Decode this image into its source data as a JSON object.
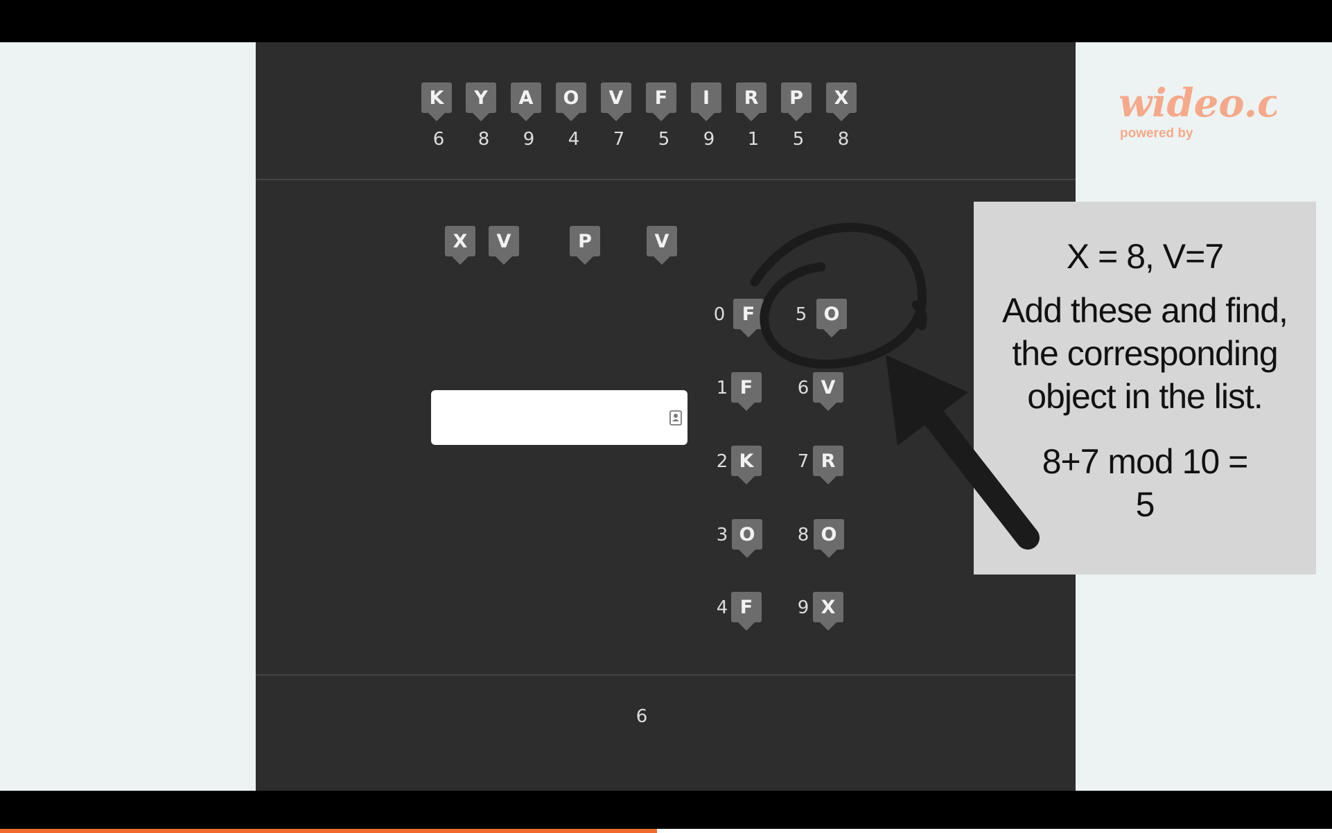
{
  "top_row": {
    "letters": [
      "K",
      "Y",
      "A",
      "O",
      "V",
      "F",
      "I",
      "R",
      "P",
      "X"
    ],
    "numbers": [
      "6",
      "8",
      "9",
      "4",
      "7",
      "5",
      "9",
      "1",
      "5",
      "8"
    ]
  },
  "query": {
    "letters": [
      "X",
      "V",
      "P",
      "V"
    ]
  },
  "answer_input": {
    "value": "",
    "placeholder": ""
  },
  "list": {
    "left": [
      {
        "index": "0",
        "letter": "F"
      },
      {
        "index": "1",
        "letter": "F"
      },
      {
        "index": "2",
        "letter": "K"
      },
      {
        "index": "3",
        "letter": "O"
      },
      {
        "index": "4",
        "letter": "F"
      }
    ],
    "right": [
      {
        "index": "5",
        "letter": "O"
      },
      {
        "index": "6",
        "letter": "V"
      },
      {
        "index": "7",
        "letter": "R"
      },
      {
        "index": "8",
        "letter": "O"
      },
      {
        "index": "9",
        "letter": "X"
      }
    ]
  },
  "footer_counter": "6",
  "note": {
    "line1": "X = 8, V=7",
    "line2": "Add these and find,",
    "line3": "the corresponding",
    "line4": "object in the list.",
    "line5": "8+7 mod 10 =",
    "line6": "5"
  },
  "brand": {
    "name": "wideo.co",
    "tagline": "powered by"
  },
  "icons": {
    "contact": "contact-card-icon",
    "annotation_circle": "circle-annotation",
    "annotation_arrow": "arrow-annotation"
  },
  "colors": {
    "panel": "#2d2d2e",
    "tag": "#6c6c6d",
    "brand": "#f5a98a",
    "progress": "#f06a2e",
    "background": "#edf3f3",
    "note": "#d6d6d6"
  },
  "playback_progress": 0.493
}
